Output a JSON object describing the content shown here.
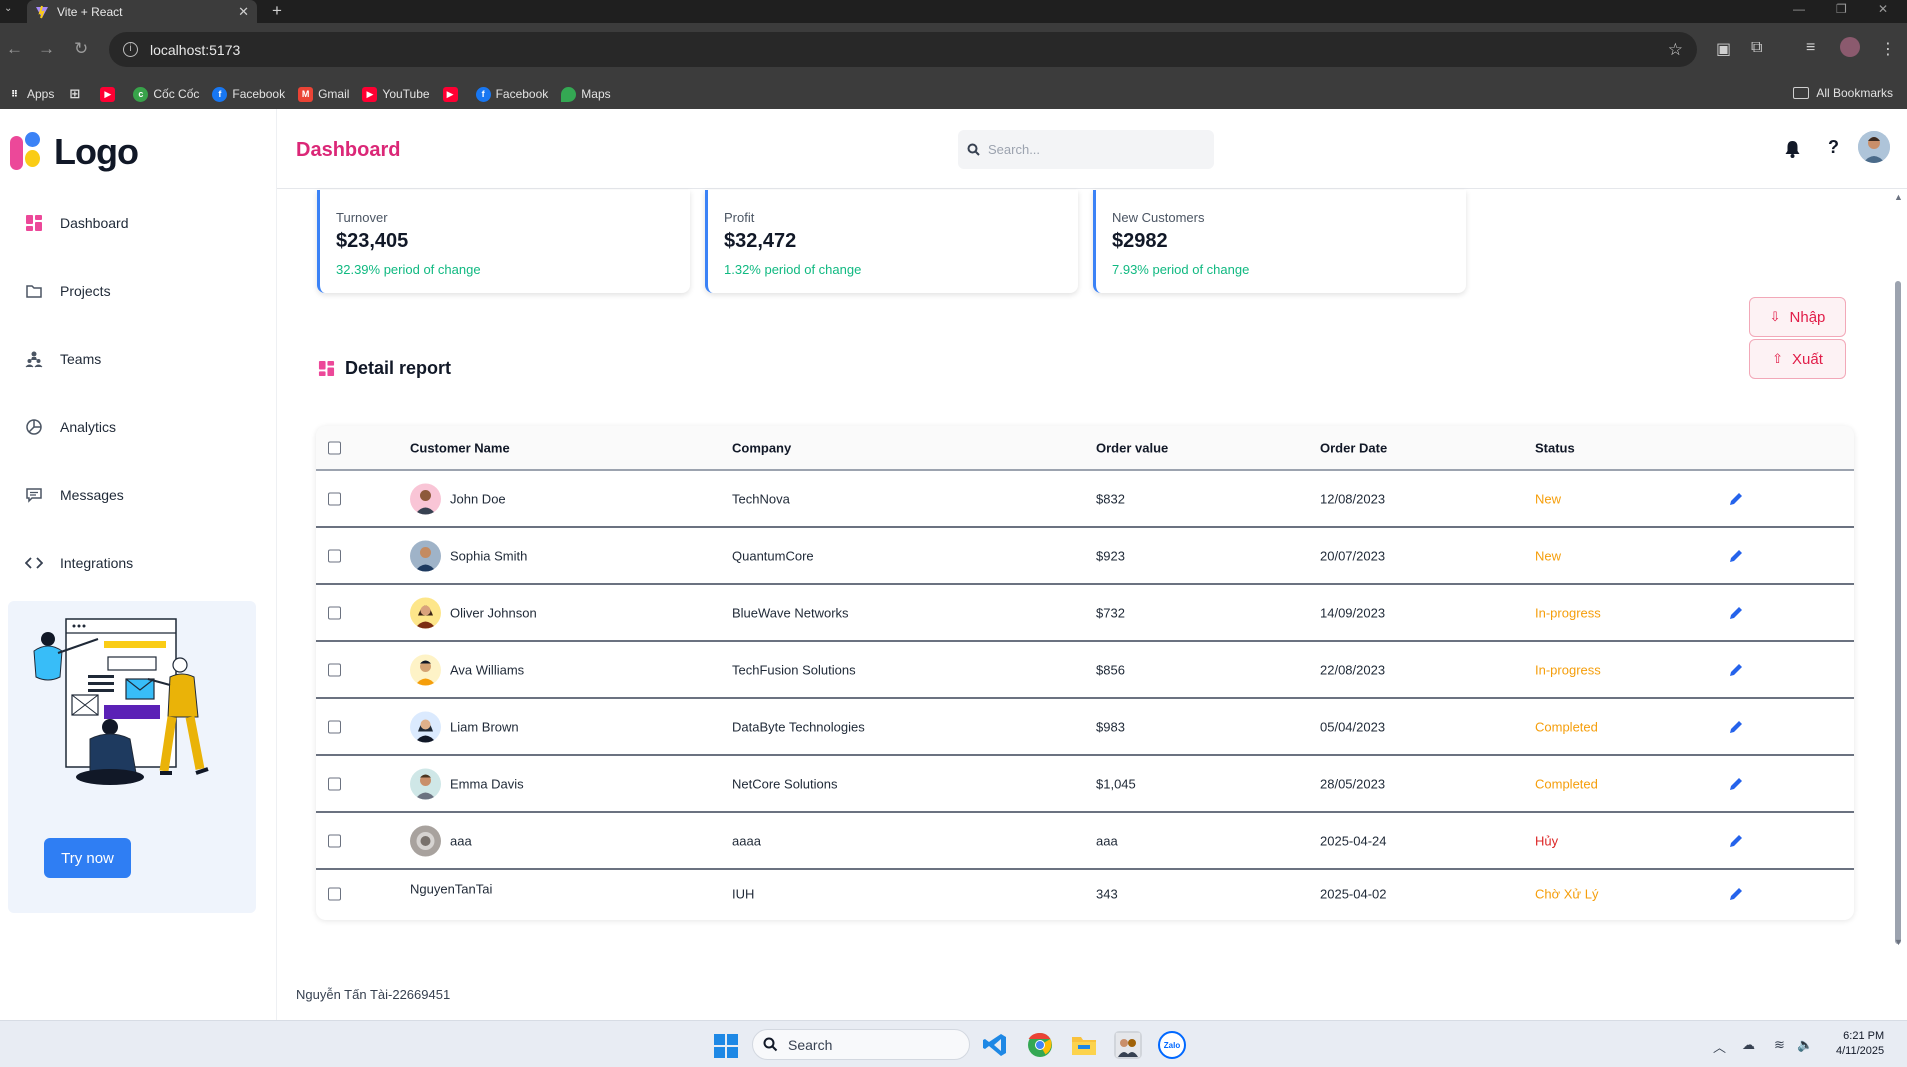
{
  "browser": {
    "tab_title": "Vite + React",
    "url": "localhost:5173",
    "bookmarks": [
      "Apps",
      "Cốc Cốc",
      "Facebook",
      "Gmail",
      "YouTube",
      "Facebook",
      "Maps"
    ],
    "all_bookmarks": "All Bookmarks"
  },
  "sidebar": {
    "logo": "Logo",
    "items": [
      {
        "label": "Dashboard",
        "icon": "grid-icon"
      },
      {
        "label": "Projects",
        "icon": "folder-icon"
      },
      {
        "label": "Teams",
        "icon": "team-icon"
      },
      {
        "label": "Analytics",
        "icon": "pie-chart-icon"
      },
      {
        "label": "Messages",
        "icon": "message-icon"
      },
      {
        "label": "Integrations",
        "icon": "code-icon"
      }
    ],
    "promo_button": "Try now"
  },
  "header": {
    "title": "Dashboard",
    "search_placeholder": "Search..."
  },
  "cards": [
    {
      "label": "Turnover",
      "value": "$23,405",
      "change": "32.39% period of change"
    },
    {
      "label": "Profit",
      "value": "$32,472",
      "change": "1.32% period of change"
    },
    {
      "label": "New Customers",
      "value": "$2982",
      "change": "7.93% period of change"
    }
  ],
  "report": {
    "title": "Detail report",
    "import_label": "Nhập",
    "export_label": "Xuất",
    "columns": [
      "Customer Name",
      "Company",
      "Order value",
      "Order Date",
      "Status"
    ],
    "rows": [
      {
        "name": "John Doe",
        "company": "TechNova",
        "value": "$832",
        "date": "12/08/2023",
        "status": "New"
      },
      {
        "name": "Sophia Smith",
        "company": "QuantumCore",
        "value": "$923",
        "date": "20/07/2023",
        "status": "New"
      },
      {
        "name": "Oliver Johnson",
        "company": "BlueWave Networks",
        "value": "$732",
        "date": "14/09/2023",
        "status": "In-progress"
      },
      {
        "name": "Ava Williams",
        "company": "TechFusion Solutions",
        "value": "$856",
        "date": "22/08/2023",
        "status": "In-progress"
      },
      {
        "name": "Liam Brown",
        "company": "DataByte Technologies",
        "value": "$983",
        "date": "05/04/2023",
        "status": "Completed"
      },
      {
        "name": "Emma Davis",
        "company": "NetCore Solutions",
        "value": "$1,045",
        "date": "28/05/2023",
        "status": "Completed"
      },
      {
        "name": "aaa",
        "company": "aaaa",
        "value": "aaa",
        "date": "2025-04-24",
        "status": "Hủy"
      },
      {
        "name": "NguyenTanTai",
        "company": "IUH",
        "value": "343",
        "date": "2025-04-02",
        "status": "Chờ Xử Lý"
      }
    ]
  },
  "footer": "Nguyễn Tấn Tài-22669451",
  "taskbar": {
    "search_label": "Search",
    "time": "6:21 PM",
    "date": "4/11/2025"
  },
  "colors": {
    "accent_pink": "#db2777",
    "card_border": "#3b82f6",
    "change_green": "#10b981",
    "status_orange": "#f59e0b",
    "status_red": "#dc2626",
    "edit_blue": "#2563eb"
  }
}
